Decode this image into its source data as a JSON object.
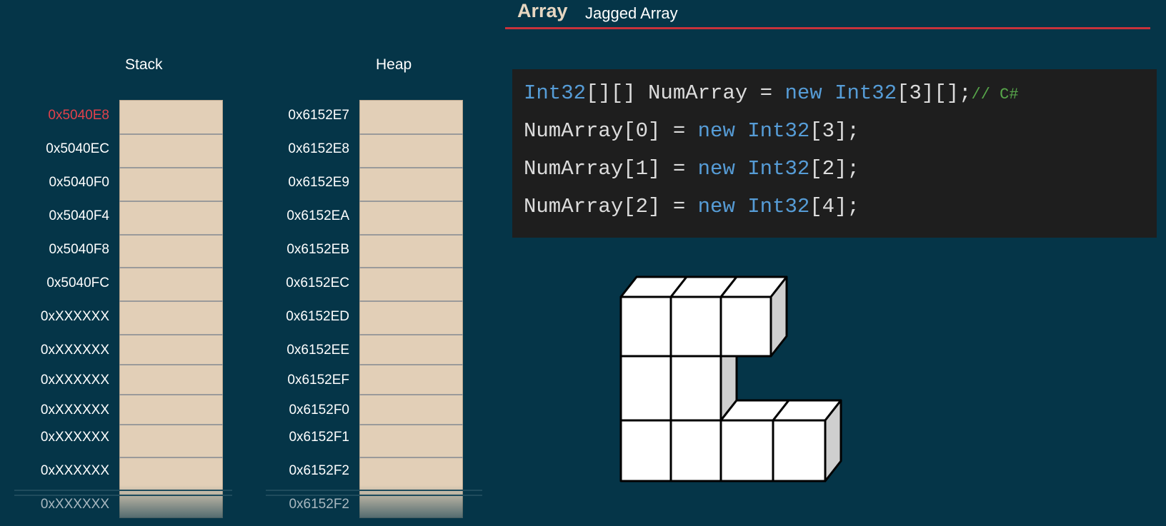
{
  "header": {
    "title": "Array",
    "subtitle": "Jagged Array"
  },
  "stack": {
    "title": "Stack",
    "addresses": [
      "0x5040E8",
      "0x5040EC",
      "0x5040F0",
      "0x5040F4",
      "0x5040F8",
      "0x5040FC",
      "0xXXXXXX",
      "0xXXXXXX",
      "0xXXXXXX",
      "0xXXXXXX",
      "0xXXXXXX",
      "0xXXXXXX",
      "0xXXXXXX"
    ]
  },
  "heap": {
    "title": "Heap",
    "addresses": [
      "0x6152E7",
      "0x6152E8",
      "0x6152E9",
      "0x6152EA",
      "0x6152EB",
      "0x6152EC",
      "0x6152ED",
      "0x6152EE",
      "0x6152EF",
      "0x6152F0",
      "0x6152F1",
      "0x6152F2",
      "0x6152F2"
    ]
  },
  "code": {
    "l1": {
      "t1": "Int32",
      "t2": "[][] NumArray = ",
      "t3": "new",
      "t4": " ",
      "t5": "Int32",
      "t6": "[3][];",
      "t7": "// C#"
    },
    "l2": {
      "t1": "NumArray[0] = ",
      "t2": "new",
      "t3": " ",
      "t4": "Int32",
      "t5": "[3];"
    },
    "l3": {
      "t1": "NumArray[1] = ",
      "t2": "new",
      "t3": " ",
      "t4": "Int32",
      "t5": "[2];"
    },
    "l4": {
      "t1": "NumArray[2] = ",
      "t2": "new",
      "t3": " ",
      "t4": "Int32",
      "t5": "[4];"
    }
  },
  "colors": {
    "background": "#053548",
    "accent": "#c7323b",
    "cell": "#e2cfb7",
    "highlight": "#e2414b",
    "keyword": "#569cd6",
    "comment": "#57a64a"
  }
}
